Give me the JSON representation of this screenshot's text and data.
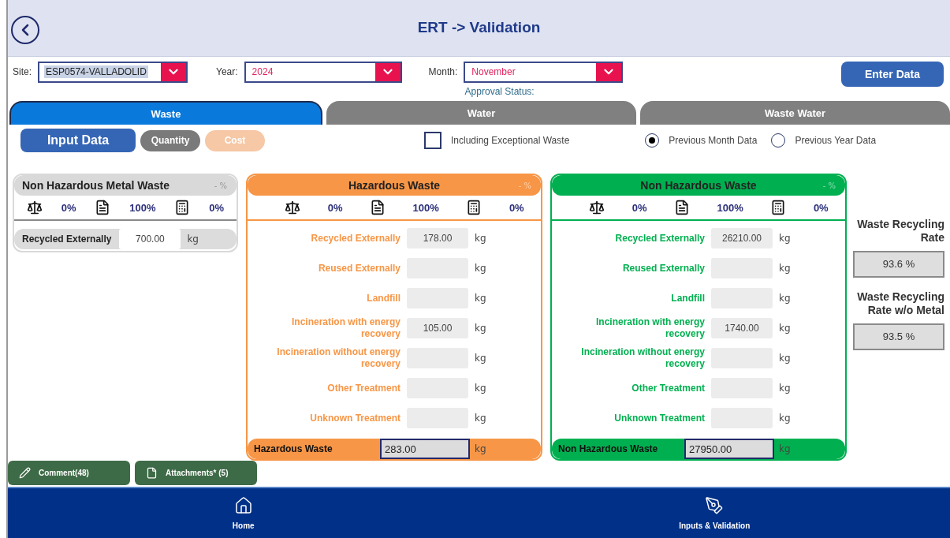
{
  "header": {
    "title": "ERT -> Validation"
  },
  "filters": [
    {
      "label": "Site:",
      "value": "ESP0574-VALLADOLID",
      "highlighted": true
    },
    {
      "label": "Year:",
      "value": "2024",
      "highlighted": false
    },
    {
      "label": "Month:",
      "value": "November",
      "highlighted": false
    }
  ],
  "approval_status": "Approval Status:",
  "enter_button": "Enter Data",
  "tabs": [
    {
      "label": "Waste",
      "selected": true
    },
    {
      "label": "Water",
      "selected": false
    },
    {
      "label": "Waste Water",
      "selected": false
    }
  ],
  "mode_buttons": [
    {
      "label": "Input Data",
      "kind": "primary"
    },
    {
      "label": "Quantity",
      "kind": "grey"
    },
    {
      "label": "Cost",
      "kind": "faded"
    }
  ],
  "exceptional": {
    "label": "Including Exceptional Waste",
    "checked": false
  },
  "data_source": [
    {
      "label": "Previous Month Data",
      "selected": true
    },
    {
      "label": "Previous Year Data",
      "selected": false
    }
  ],
  "cards": [
    {
      "kind": "compact",
      "color": "#d9d9d9",
      "title": "Non Hazardous Metal Waste",
      "percent": "- %",
      "stats": [
        {
          "kind": "scale",
          "value": "0%"
        },
        {
          "kind": "document",
          "value": "100%"
        },
        {
          "kind": "calculator",
          "value": "0%"
        }
      ],
      "rows": [
        {
          "label": "Recycled Externally",
          "value": "700.00",
          "unit": "kg"
        }
      ]
    },
    {
      "kind": "full",
      "color": "#f79646",
      "title": "Hazardous Waste",
      "percent": "- %",
      "stats": [
        {
          "kind": "scale",
          "value": "0%"
        },
        {
          "kind": "document",
          "value": "100%"
        },
        {
          "kind": "calculator",
          "value": "0%"
        }
      ],
      "rows": [
        {
          "label": "Recycled Externally",
          "value": "178.00",
          "unit": "kg"
        },
        {
          "label": "Reused Externally",
          "value": "",
          "unit": "kg"
        },
        {
          "label": "Landfill",
          "value": "",
          "unit": "kg"
        },
        {
          "label": "Incineration with energy recovery",
          "value": "105.00",
          "unit": "kg"
        },
        {
          "label": "Incineration without energy recovery",
          "value": "",
          "unit": "kg"
        },
        {
          "label": "Other Treatment",
          "value": "",
          "unit": "kg"
        },
        {
          "label": "Unknown Treatment",
          "value": "",
          "unit": "kg"
        }
      ],
      "total": {
        "label": "Hazardous Waste",
        "value": "283.00",
        "unit": "kg"
      }
    },
    {
      "kind": "full",
      "color": "#00b050",
      "title": "Non Hazardous  Waste",
      "percent": "- %",
      "stats": [
        {
          "kind": "scale",
          "value": "0%"
        },
        {
          "kind": "document",
          "value": "100%"
        },
        {
          "kind": "calculator",
          "value": "0%"
        }
      ],
      "rows": [
        {
          "label": "Recycled Externally",
          "value": "26210.00",
          "unit": "kg"
        },
        {
          "label": "Reused Externally",
          "value": "",
          "unit": "kg"
        },
        {
          "label": "Landfill",
          "value": "",
          "unit": "kg"
        },
        {
          "label": "Incineration with energy recovery",
          "value": "1740.00",
          "unit": "kg"
        },
        {
          "label": "Incineration without energy recovery",
          "value": "",
          "unit": "kg"
        },
        {
          "label": "Other Treatment",
          "value": "",
          "unit": "kg"
        },
        {
          "label": "Unknown Treatment",
          "value": "",
          "unit": "kg"
        }
      ],
      "total": {
        "label": "Non Hazardous  Waste",
        "value": "27950.00",
        "unit": "kg"
      }
    }
  ],
  "rates": [
    {
      "label": "Waste Recycling Rate",
      "value": "93.6 %"
    },
    {
      "label": "Waste Recycling Rate w/o Metal",
      "value": "93.5 %"
    }
  ],
  "actions": [
    {
      "kind": "pencil",
      "label": "Comment(48)"
    },
    {
      "kind": "file",
      "label": "Attachments* (5)"
    }
  ],
  "nav": [
    {
      "kind": "home",
      "label": "Home"
    },
    {
      "kind": "pen",
      "label": "Inputs & Validation"
    }
  ]
}
